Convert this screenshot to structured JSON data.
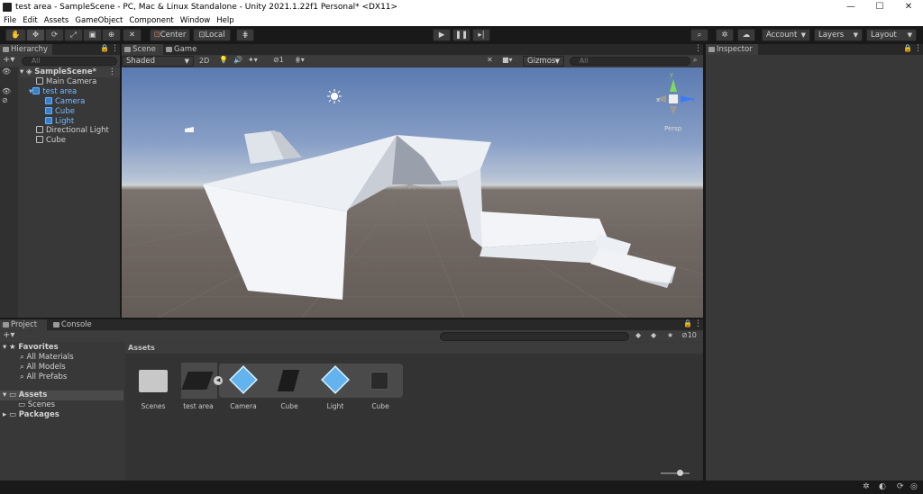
{
  "window": {
    "title": "test area - SampleScene - PC, Mac & Linux Standalone - Unity 2021.1.22f1 Personal* <DX11>",
    "minimize": "—",
    "maximize": "☐",
    "close": "✕"
  },
  "menu": [
    "File",
    "Edit",
    "Assets",
    "GameObject",
    "Component",
    "Window",
    "Help"
  ],
  "toolbar": {
    "pivot_label": "Center",
    "space_label": "Local",
    "account_label": "Account",
    "layers_label": "Layers",
    "layout_label": "Layout"
  },
  "hierarchy": {
    "tab_label": "Hierarchy",
    "search_placeholder": "All",
    "scene_name": "SampleScene*",
    "items": [
      {
        "label": "Main Camera",
        "blue": false
      },
      {
        "label": "test area",
        "blue": true
      },
      {
        "label": "Camera",
        "blue": true
      },
      {
        "label": "Cube",
        "blue": true
      },
      {
        "label": "Light",
        "blue": true
      },
      {
        "label": "Directional Light",
        "blue": false
      },
      {
        "label": "Cube",
        "blue": false
      }
    ]
  },
  "scene": {
    "tab_scene": "Scene",
    "tab_game": "Game",
    "shading_mode": "Shaded",
    "mode_2d": "2D",
    "hidden_count": "1",
    "gizmos_label": "Gizmos",
    "search_placeholder": "All",
    "persp_label": "Persp",
    "axis_y": "y",
    "axis_x": "x",
    "axis_z": "z"
  },
  "inspector": {
    "tab_label": "Inspector"
  },
  "project": {
    "tab_project": "Project",
    "tab_console": "Console",
    "favorites_label": "Favorites",
    "favorites_items": [
      "All Materials",
      "All Models",
      "All Prefabs"
    ],
    "assets_root": "Assets",
    "assets_children": [
      "Scenes"
    ],
    "packages_label": "Packages",
    "breadcrumb": "Assets",
    "hidden_count": "10",
    "assets": [
      "Scenes",
      "test area",
      "Camera",
      "Cube",
      "Light",
      "Cube"
    ]
  },
  "colors": {
    "accent_blue": "#7cb9ff",
    "panel_bg": "#383838",
    "toolbar_bg": "#191919"
  }
}
